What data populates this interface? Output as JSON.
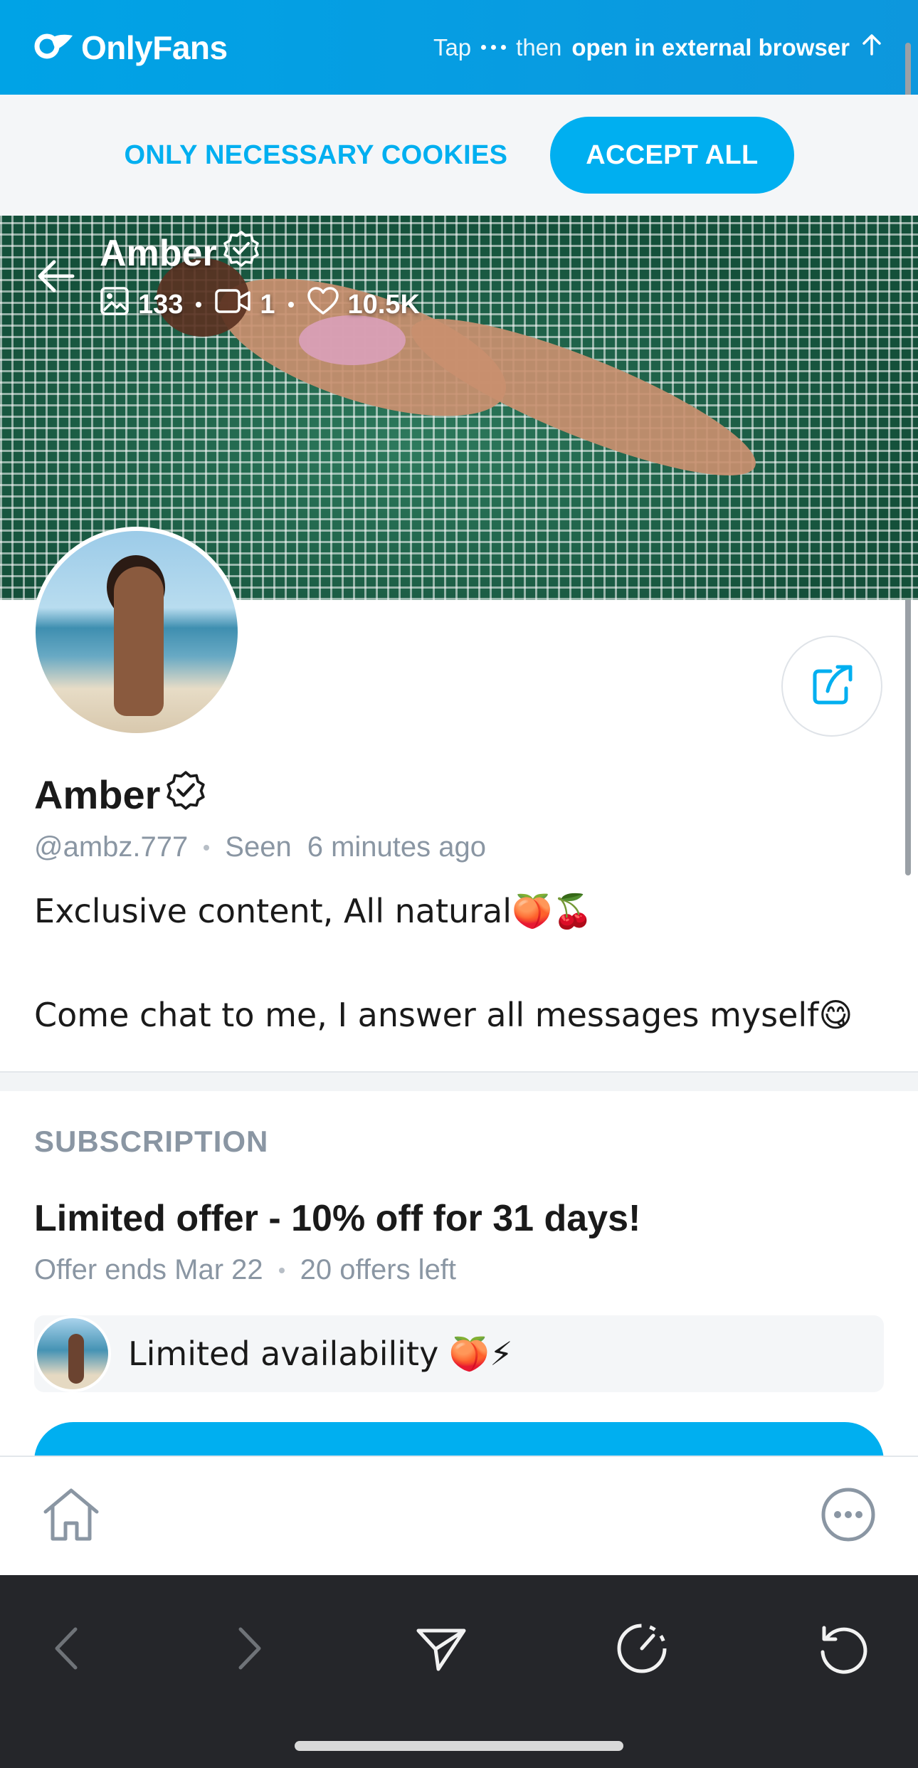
{
  "topbar": {
    "brand": "OnlyFans",
    "hint_tap": "Tap",
    "hint_then": "then",
    "hint_action": "open in external browser"
  },
  "cookies": {
    "necessary_label": "ONLY NECESSARY COOKIES",
    "accept_label": "ACCEPT ALL"
  },
  "cover": {
    "name": "Amber",
    "photos_count": "133",
    "videos_count": "1",
    "likes_count": "10.5K"
  },
  "profile": {
    "name": "Amber",
    "handle": "@ambz.777",
    "seen_label": "Seen",
    "seen_time": "6 minutes ago",
    "bio_line_1": "Exclusive content, All natural🍑🍒",
    "bio_line_2": "Come chat to me, I answer all messages myself😋"
  },
  "subscription": {
    "section_title": "SUBSCRIPTION",
    "offer_title": "Limited offer - 10% off for 31 days!",
    "offer_ends": "Offer ends Mar 22",
    "offers_left": "20 offers left",
    "promo_text": "Limited availability 🍑⚡"
  },
  "icons": {
    "logo": "onlyfans-logo-icon",
    "back": "arrow-left-icon",
    "verified": "verified-badge-icon",
    "photos": "image-icon",
    "videos": "video-icon",
    "likes": "heart-icon",
    "share": "share-icon",
    "home": "home-icon",
    "more": "more-icon",
    "browser_back": "chevron-left-icon",
    "browser_forward": "chevron-right-icon",
    "send": "send-icon",
    "speed": "gauge-icon",
    "reload": "reload-icon"
  },
  "colors": {
    "brand_blue": "#00aff0",
    "muted_text": "#8a96a3",
    "browser_bar": "#25262a"
  }
}
